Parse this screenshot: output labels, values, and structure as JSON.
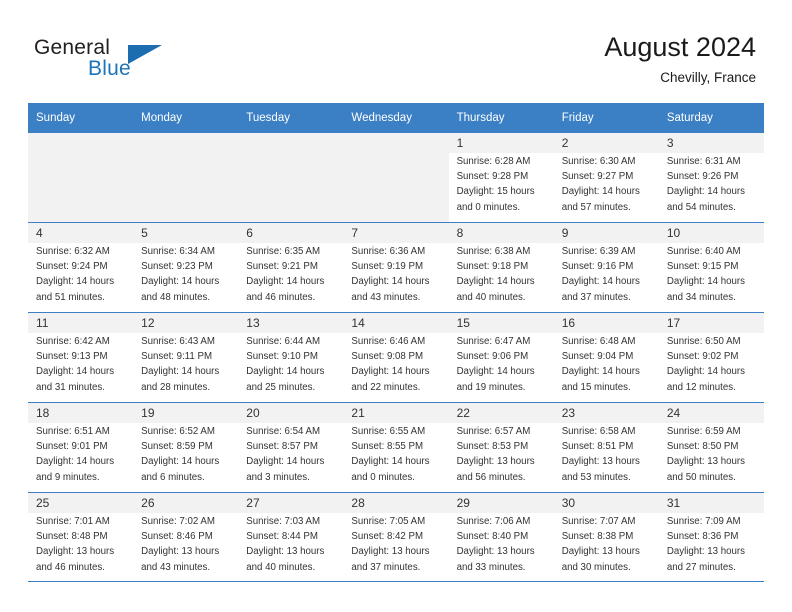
{
  "logo": {
    "top_text": "General",
    "bottom_text": "Blue",
    "triangle_color": "#1b6cb0",
    "blue_color": "#1b75bb"
  },
  "header": {
    "title": "August 2024",
    "subtitle": "Chevilly, France"
  },
  "theme": {
    "header_row_bg": "#3b7fc4",
    "header_row_text": "#ffffff",
    "daynum_bg": "#f2f2f2",
    "grid_line": "#3b7fc4"
  },
  "calendar": {
    "weekday_headers": [
      "Sunday",
      "Monday",
      "Tuesday",
      "Wednesday",
      "Thursday",
      "Friday",
      "Saturday"
    ],
    "weeks": [
      [
        {
          "day": "",
          "sunrise": "",
          "sunset": "",
          "daylight1": "",
          "daylight2": "",
          "empty": true
        },
        {
          "day": "",
          "sunrise": "",
          "sunset": "",
          "daylight1": "",
          "daylight2": "",
          "empty": true
        },
        {
          "day": "",
          "sunrise": "",
          "sunset": "",
          "daylight1": "",
          "daylight2": "",
          "empty": true
        },
        {
          "day": "",
          "sunrise": "",
          "sunset": "",
          "daylight1": "",
          "daylight2": "",
          "empty": true
        },
        {
          "day": "1",
          "sunrise": "Sunrise: 6:28 AM",
          "sunset": "Sunset: 9:28 PM",
          "daylight1": "Daylight: 15 hours",
          "daylight2": "and 0 minutes.",
          "empty": false
        },
        {
          "day": "2",
          "sunrise": "Sunrise: 6:30 AM",
          "sunset": "Sunset: 9:27 PM",
          "daylight1": "Daylight: 14 hours",
          "daylight2": "and 57 minutes.",
          "empty": false
        },
        {
          "day": "3",
          "sunrise": "Sunrise: 6:31 AM",
          "sunset": "Sunset: 9:26 PM",
          "daylight1": "Daylight: 14 hours",
          "daylight2": "and 54 minutes.",
          "empty": false
        }
      ],
      [
        {
          "day": "4",
          "sunrise": "Sunrise: 6:32 AM",
          "sunset": "Sunset: 9:24 PM",
          "daylight1": "Daylight: 14 hours",
          "daylight2": "and 51 minutes.",
          "empty": false
        },
        {
          "day": "5",
          "sunrise": "Sunrise: 6:34 AM",
          "sunset": "Sunset: 9:23 PM",
          "daylight1": "Daylight: 14 hours",
          "daylight2": "and 48 minutes.",
          "empty": false
        },
        {
          "day": "6",
          "sunrise": "Sunrise: 6:35 AM",
          "sunset": "Sunset: 9:21 PM",
          "daylight1": "Daylight: 14 hours",
          "daylight2": "and 46 minutes.",
          "empty": false
        },
        {
          "day": "7",
          "sunrise": "Sunrise: 6:36 AM",
          "sunset": "Sunset: 9:19 PM",
          "daylight1": "Daylight: 14 hours",
          "daylight2": "and 43 minutes.",
          "empty": false
        },
        {
          "day": "8",
          "sunrise": "Sunrise: 6:38 AM",
          "sunset": "Sunset: 9:18 PM",
          "daylight1": "Daylight: 14 hours",
          "daylight2": "and 40 minutes.",
          "empty": false
        },
        {
          "day": "9",
          "sunrise": "Sunrise: 6:39 AM",
          "sunset": "Sunset: 9:16 PM",
          "daylight1": "Daylight: 14 hours",
          "daylight2": "and 37 minutes.",
          "empty": false
        },
        {
          "day": "10",
          "sunrise": "Sunrise: 6:40 AM",
          "sunset": "Sunset: 9:15 PM",
          "daylight1": "Daylight: 14 hours",
          "daylight2": "and 34 minutes.",
          "empty": false
        }
      ],
      [
        {
          "day": "11",
          "sunrise": "Sunrise: 6:42 AM",
          "sunset": "Sunset: 9:13 PM",
          "daylight1": "Daylight: 14 hours",
          "daylight2": "and 31 minutes.",
          "empty": false
        },
        {
          "day": "12",
          "sunrise": "Sunrise: 6:43 AM",
          "sunset": "Sunset: 9:11 PM",
          "daylight1": "Daylight: 14 hours",
          "daylight2": "and 28 minutes.",
          "empty": false
        },
        {
          "day": "13",
          "sunrise": "Sunrise: 6:44 AM",
          "sunset": "Sunset: 9:10 PM",
          "daylight1": "Daylight: 14 hours",
          "daylight2": "and 25 minutes.",
          "empty": false
        },
        {
          "day": "14",
          "sunrise": "Sunrise: 6:46 AM",
          "sunset": "Sunset: 9:08 PM",
          "daylight1": "Daylight: 14 hours",
          "daylight2": "and 22 minutes.",
          "empty": false
        },
        {
          "day": "15",
          "sunrise": "Sunrise: 6:47 AM",
          "sunset": "Sunset: 9:06 PM",
          "daylight1": "Daylight: 14 hours",
          "daylight2": "and 19 minutes.",
          "empty": false
        },
        {
          "day": "16",
          "sunrise": "Sunrise: 6:48 AM",
          "sunset": "Sunset: 9:04 PM",
          "daylight1": "Daylight: 14 hours",
          "daylight2": "and 15 minutes.",
          "empty": false
        },
        {
          "day": "17",
          "sunrise": "Sunrise: 6:50 AM",
          "sunset": "Sunset: 9:02 PM",
          "daylight1": "Daylight: 14 hours",
          "daylight2": "and 12 minutes.",
          "empty": false
        }
      ],
      [
        {
          "day": "18",
          "sunrise": "Sunrise: 6:51 AM",
          "sunset": "Sunset: 9:01 PM",
          "daylight1": "Daylight: 14 hours",
          "daylight2": "and 9 minutes.",
          "empty": false
        },
        {
          "day": "19",
          "sunrise": "Sunrise: 6:52 AM",
          "sunset": "Sunset: 8:59 PM",
          "daylight1": "Daylight: 14 hours",
          "daylight2": "and 6 minutes.",
          "empty": false
        },
        {
          "day": "20",
          "sunrise": "Sunrise: 6:54 AM",
          "sunset": "Sunset: 8:57 PM",
          "daylight1": "Daylight: 14 hours",
          "daylight2": "and 3 minutes.",
          "empty": false
        },
        {
          "day": "21",
          "sunrise": "Sunrise: 6:55 AM",
          "sunset": "Sunset: 8:55 PM",
          "daylight1": "Daylight: 14 hours",
          "daylight2": "and 0 minutes.",
          "empty": false
        },
        {
          "day": "22",
          "sunrise": "Sunrise: 6:57 AM",
          "sunset": "Sunset: 8:53 PM",
          "daylight1": "Daylight: 13 hours",
          "daylight2": "and 56 minutes.",
          "empty": false
        },
        {
          "day": "23",
          "sunrise": "Sunrise: 6:58 AM",
          "sunset": "Sunset: 8:51 PM",
          "daylight1": "Daylight: 13 hours",
          "daylight2": "and 53 minutes.",
          "empty": false
        },
        {
          "day": "24",
          "sunrise": "Sunrise: 6:59 AM",
          "sunset": "Sunset: 8:50 PM",
          "daylight1": "Daylight: 13 hours",
          "daylight2": "and 50 minutes.",
          "empty": false
        }
      ],
      [
        {
          "day": "25",
          "sunrise": "Sunrise: 7:01 AM",
          "sunset": "Sunset: 8:48 PM",
          "daylight1": "Daylight: 13 hours",
          "daylight2": "and 46 minutes.",
          "empty": false
        },
        {
          "day": "26",
          "sunrise": "Sunrise: 7:02 AM",
          "sunset": "Sunset: 8:46 PM",
          "daylight1": "Daylight: 13 hours",
          "daylight2": "and 43 minutes.",
          "empty": false
        },
        {
          "day": "27",
          "sunrise": "Sunrise: 7:03 AM",
          "sunset": "Sunset: 8:44 PM",
          "daylight1": "Daylight: 13 hours",
          "daylight2": "and 40 minutes.",
          "empty": false
        },
        {
          "day": "28",
          "sunrise": "Sunrise: 7:05 AM",
          "sunset": "Sunset: 8:42 PM",
          "daylight1": "Daylight: 13 hours",
          "daylight2": "and 37 minutes.",
          "empty": false
        },
        {
          "day": "29",
          "sunrise": "Sunrise: 7:06 AM",
          "sunset": "Sunset: 8:40 PM",
          "daylight1": "Daylight: 13 hours",
          "daylight2": "and 33 minutes.",
          "empty": false
        },
        {
          "day": "30",
          "sunrise": "Sunrise: 7:07 AM",
          "sunset": "Sunset: 8:38 PM",
          "daylight1": "Daylight: 13 hours",
          "daylight2": "and 30 minutes.",
          "empty": false
        },
        {
          "day": "31",
          "sunrise": "Sunrise: 7:09 AM",
          "sunset": "Sunset: 8:36 PM",
          "daylight1": "Daylight: 13 hours",
          "daylight2": "and 27 minutes.",
          "empty": false
        }
      ]
    ]
  }
}
